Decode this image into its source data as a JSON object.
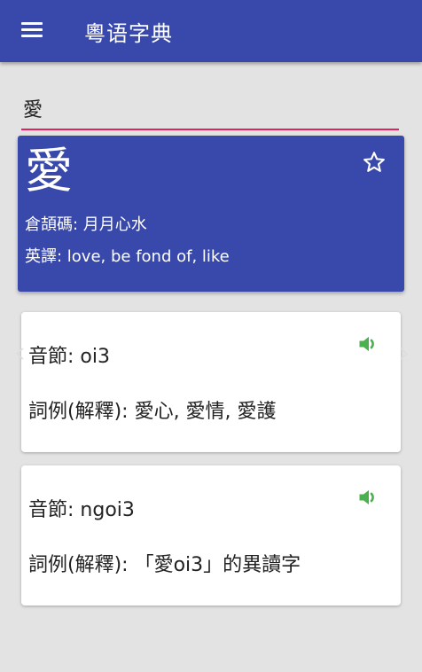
{
  "app": {
    "title": "粵语字典"
  },
  "search": {
    "value": "愛"
  },
  "entry": {
    "character": "愛",
    "cangjie": "倉頡碼: 月月心水",
    "english": "英譯: love, be fond of, like"
  },
  "readings": [
    {
      "syllable": "音節: oi3",
      "examples": "詞例(解釋): 愛心, 愛情, 愛護"
    },
    {
      "syllable": "音節: ngoi3",
      "examples": "詞例(解釋): 「愛oi3」的異讀字"
    }
  ],
  "colors": {
    "primary": "#3949ab",
    "accent": "#e91e63",
    "speaker": "#4caf50"
  },
  "icons": [
    "menu-icon",
    "star-outline-icon",
    "speaker-icon",
    "chevron-left-icon",
    "chevron-right-icon"
  ]
}
